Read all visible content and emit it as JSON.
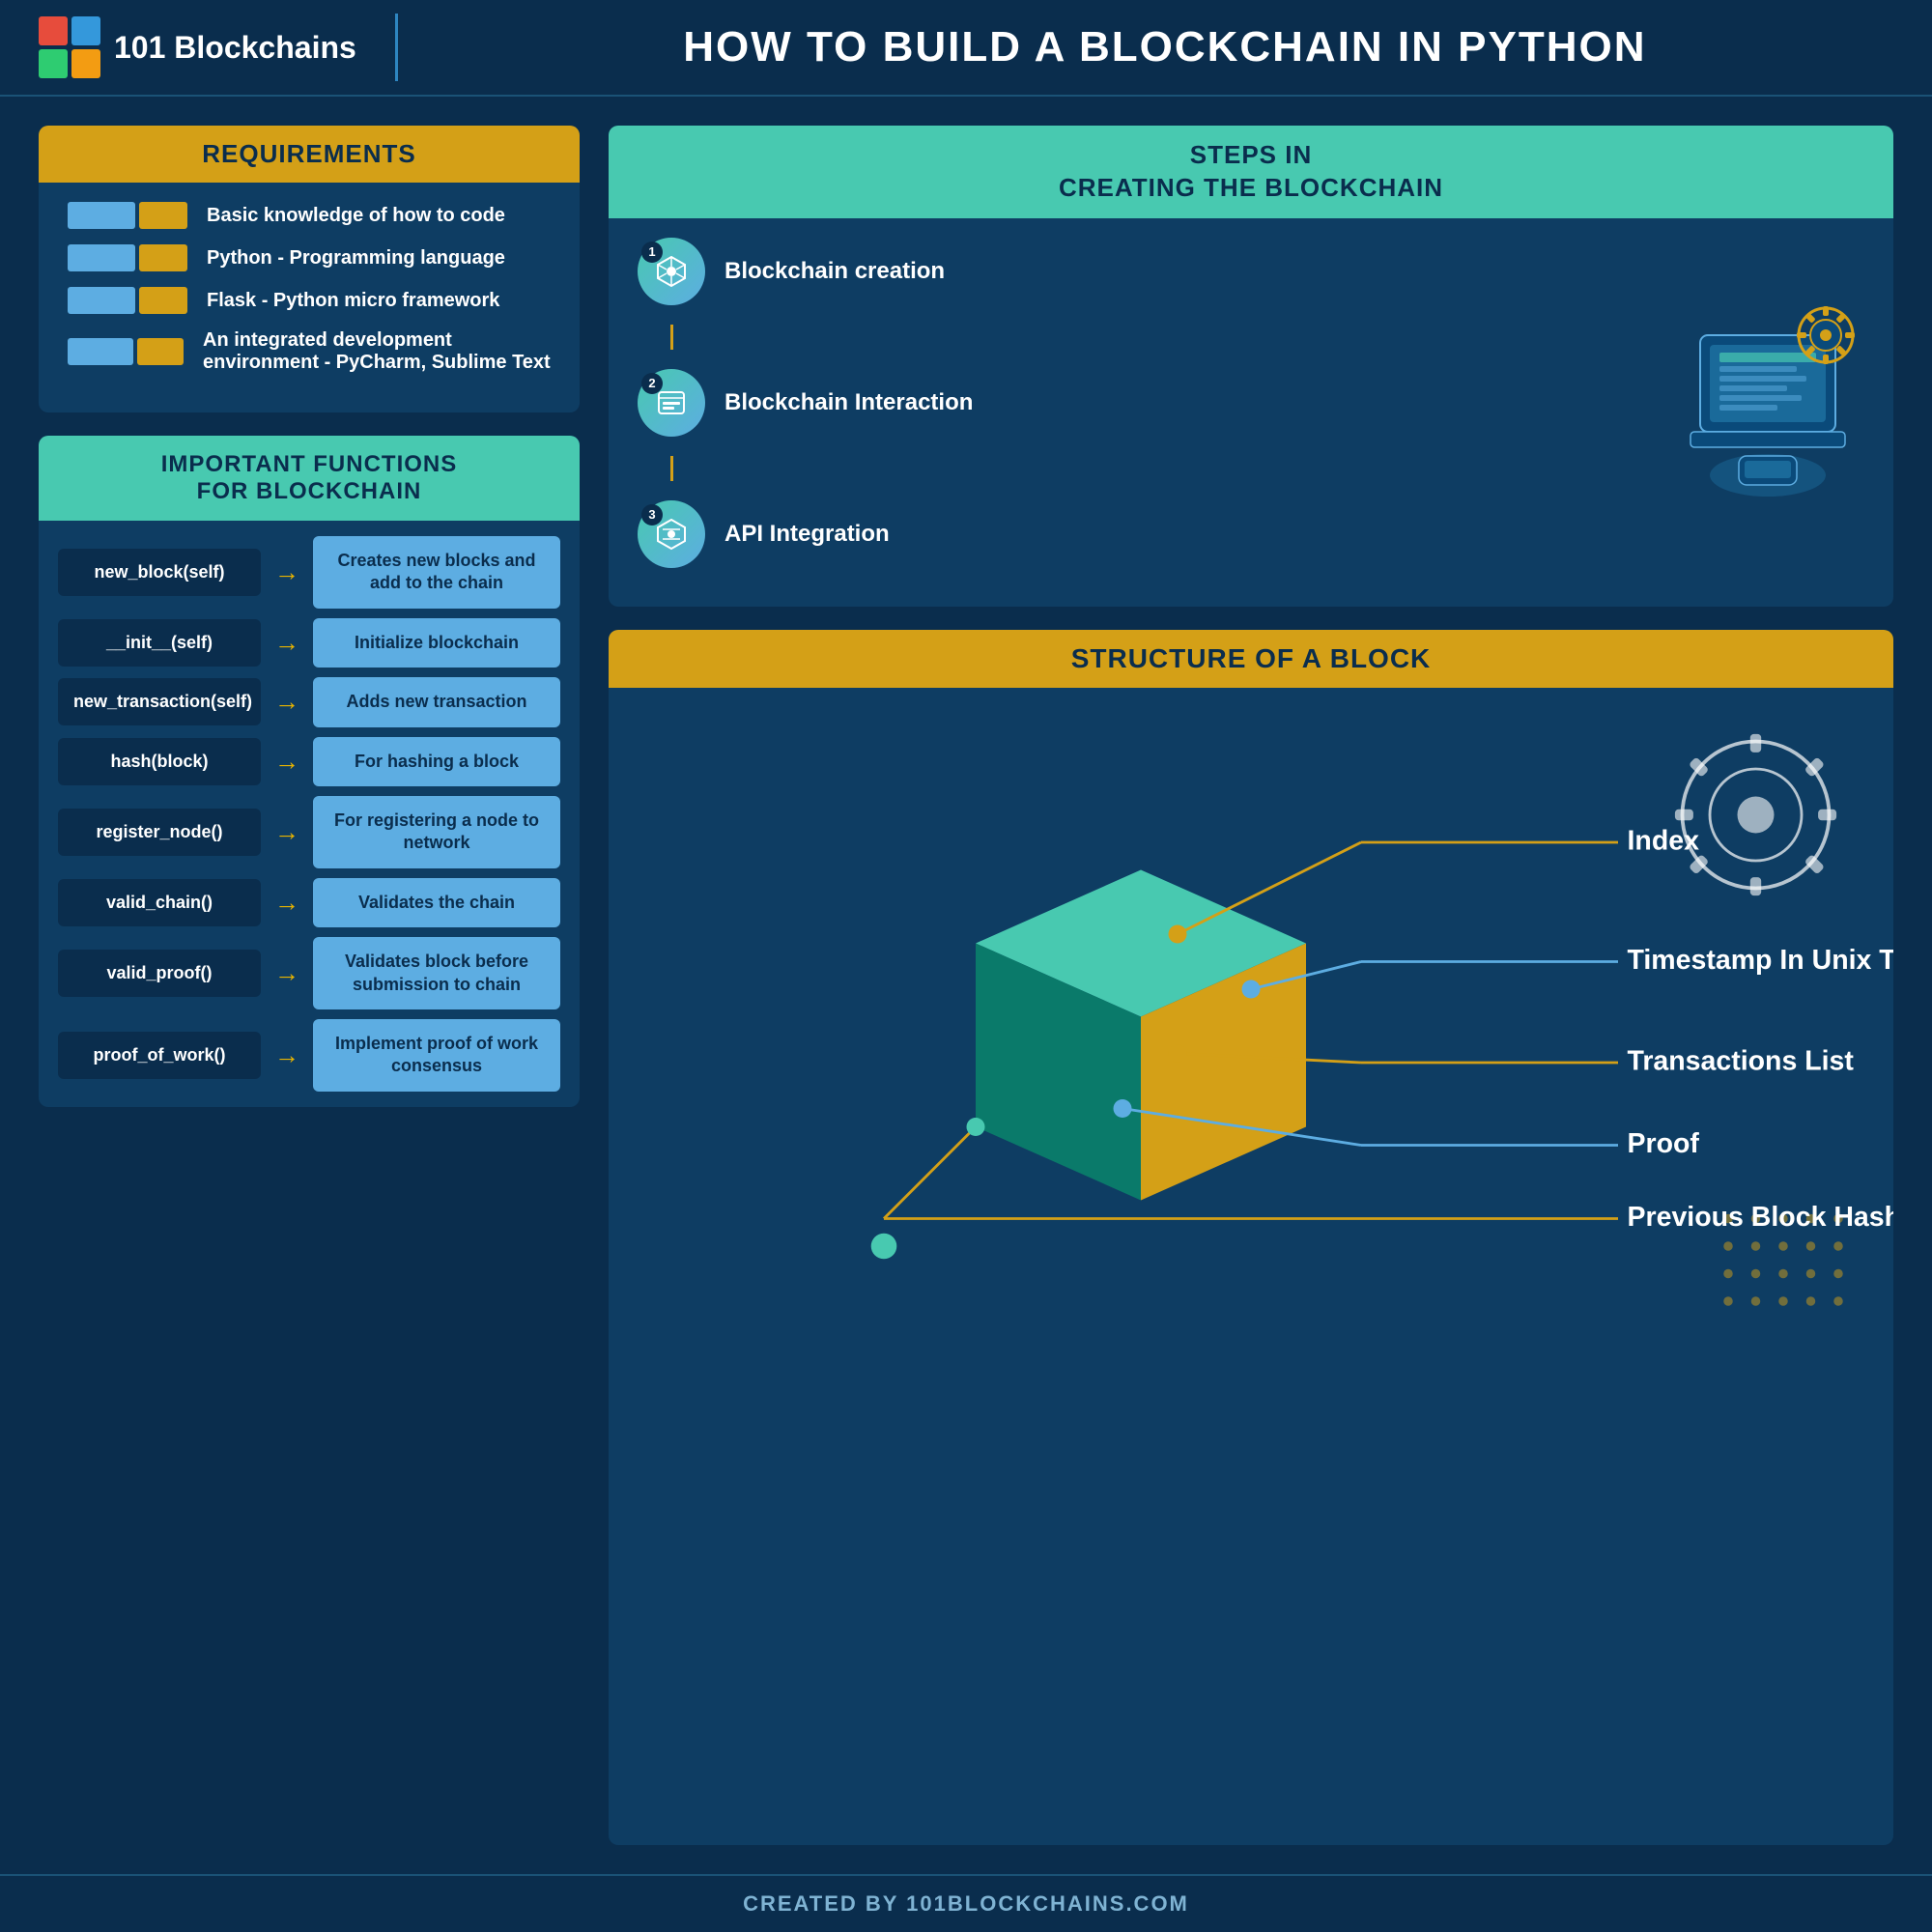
{
  "header": {
    "logo_text": "101 Blockchains",
    "title": "HOW TO BUILD A BLOCKCHAIN IN PYTHON"
  },
  "requirements": {
    "heading": "REQUIREMENTS",
    "items": [
      "Basic knowledge of how to code",
      "Python - Programming language",
      "Flask - Python micro framework",
      "An integrated development environment - PyCharm, Sublime Text"
    ]
  },
  "functions": {
    "heading": "IMPORTANT FUNCTIONS\nFOR BLOCKCHAIN",
    "rows": [
      {
        "name": "new_block(self)",
        "desc": "Creates new blocks and add to the chain"
      },
      {
        "name": "__init__(self)",
        "desc": "Initialize blockchain"
      },
      {
        "name": "new_transaction(self)",
        "desc": "Adds new transaction"
      },
      {
        "name": "hash(block)",
        "desc": "For hashing a block"
      },
      {
        "name": "register_node()",
        "desc": "For registering a node to network"
      },
      {
        "name": "valid_chain()",
        "desc": "Validates the chain"
      },
      {
        "name": "valid_proof()",
        "desc": "Validates block before submission to chain"
      },
      {
        "name": "proof_of_work()",
        "desc": "Implement proof of work consensus"
      }
    ]
  },
  "steps": {
    "heading": "STEPS IN\nCREATING THE BLOCKCHAIN",
    "items": [
      {
        "number": "1",
        "label": "Blockchain creation"
      },
      {
        "number": "2",
        "label": "Blockchain Interaction"
      },
      {
        "number": "3",
        "label": "API Integration"
      }
    ]
  },
  "block_structure": {
    "heading": "STRUCTURE OF A BLOCK",
    "labels": [
      "Index",
      "Timestamp In Unix Time",
      "Transactions List",
      "Proof",
      "Previous Block Hash"
    ]
  },
  "footer": {
    "text": "CREATED BY 101BLOCKCHAINS.COM"
  }
}
